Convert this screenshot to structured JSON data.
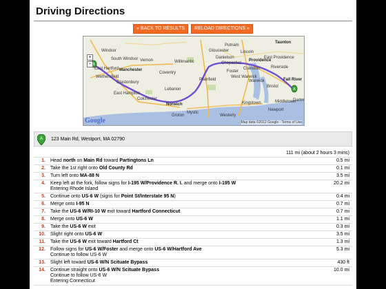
{
  "page": {
    "title": "Driving Directions"
  },
  "buttons": {
    "back": "« BACK TO RESULTS",
    "reload": "RELOAD DIRECTIONS »"
  },
  "map": {
    "labels": [
      "Windsor",
      "South Windsor",
      "Vernon",
      "East Hartford",
      "Manchester",
      "Glastonbury",
      "Willimantic",
      "Danielson",
      "Putnam",
      "Foster",
      "Coventry",
      "Lebanon",
      "Colchester",
      "Norwich",
      "Plainfield",
      "Groton",
      "Mystic",
      "Westerly",
      "Providence",
      "East Providence",
      "Cranston",
      "Warwick",
      "West Warwick",
      "Riverside",
      "Taunton",
      "Fall River",
      "Kingstown",
      "Bristol",
      "Newport",
      "Middletown",
      "Lincoln",
      "Gloucester",
      "Chepachet",
      "East Hampton",
      "Wethersfield",
      "Dartm"
    ],
    "copyright": "Map data ©2012 Google - Terms of Use",
    "logo": "Google"
  },
  "start": {
    "address": "123 Main Rd, Westport, MA 02790",
    "marker": "A"
  },
  "summary": "111 mi (about 2 hours 3 mins)",
  "steps": [
    {
      "n": "1.",
      "parts": [
        [
          "Head ",
          false
        ],
        [
          "north",
          true
        ],
        [
          " on ",
          false
        ],
        [
          "Main Rd",
          true
        ],
        [
          " toward ",
          false
        ],
        [
          "Partingtons Ln",
          true
        ]
      ],
      "extra": [],
      "dist": "0.5 mi"
    },
    {
      "n": "2.",
      "parts": [
        [
          "Take the 1st right onto ",
          false
        ],
        [
          "Old County Rd",
          true
        ]
      ],
      "extra": [],
      "dist": "0.1 mi"
    },
    {
      "n": "3.",
      "parts": [
        [
          "Turn left onto ",
          false
        ],
        [
          "MA-88 N",
          true
        ]
      ],
      "extra": [],
      "dist": "3.5 mi"
    },
    {
      "n": "4.",
      "parts": [
        [
          "Keep left at the fork, follow signs for ",
          false
        ],
        [
          "I-195 W/Providence R. I.",
          true
        ],
        [
          " and merge onto ",
          false
        ],
        [
          "I-195 W",
          true
        ]
      ],
      "extra": [
        "Entering Rhode Island"
      ],
      "dist": "20.2 mi"
    },
    {
      "n": "5.",
      "parts": [
        [
          "Continue onto ",
          false
        ],
        [
          "US-6 W",
          true
        ],
        [
          " (signs for ",
          false
        ],
        [
          "Point St/Interstate 95 N",
          true
        ],
        [
          ")",
          false
        ]
      ],
      "extra": [],
      "dist": "0.4 mi"
    },
    {
      "n": "6.",
      "parts": [
        [
          "Merge onto ",
          false
        ],
        [
          "I-95 N",
          true
        ]
      ],
      "extra": [],
      "dist": "0.7 mi"
    },
    {
      "n": "7.",
      "parts": [
        [
          "Take the ",
          false
        ],
        [
          "US-6 W/RI-10 W",
          true
        ],
        [
          " exit toward ",
          false
        ],
        [
          "Hartford Connecticut",
          true
        ]
      ],
      "extra": [],
      "dist": "0.7 mi"
    },
    {
      "n": "8.",
      "parts": [
        [
          "Merge onto ",
          false
        ],
        [
          "US-6 W",
          true
        ]
      ],
      "extra": [],
      "dist": "1.1 mi"
    },
    {
      "n": "9.",
      "parts": [
        [
          "Take the ",
          false
        ],
        [
          "US-6 W",
          true
        ],
        [
          " exit",
          false
        ]
      ],
      "extra": [],
      "dist": "0.3 mi"
    },
    {
      "n": "10.",
      "parts": [
        [
          "Slight right onto ",
          false
        ],
        [
          "US-6 W",
          true
        ]
      ],
      "extra": [],
      "dist": "3.5 mi"
    },
    {
      "n": "11.",
      "parts": [
        [
          "Take the ",
          false
        ],
        [
          "US-6 W",
          true
        ],
        [
          " exit toward ",
          false
        ],
        [
          "Hartford Ct",
          true
        ]
      ],
      "extra": [],
      "dist": "1.3 mi"
    },
    {
      "n": "12.",
      "parts": [
        [
          "Follow signs for ",
          false
        ],
        [
          "US-6 W/Foster",
          true
        ],
        [
          " and merge onto ",
          false
        ],
        [
          "US-6 W/Hartford Ave",
          true
        ]
      ],
      "extra": [
        "Continue to follow US-6 W"
      ],
      "dist": "5.3 mi"
    },
    {
      "n": "13.",
      "parts": [
        [
          "Slight left toward ",
          false
        ],
        [
          "US-6 W/N Scituate Bypass",
          true
        ]
      ],
      "extra": [],
      "dist": "430 ft"
    },
    {
      "n": "14.",
      "parts": [
        [
          "Continue straight onto ",
          false
        ],
        [
          "US-6 W/N Scituate Bypass",
          true
        ]
      ],
      "extra": [
        "Continue to follow US-6 W",
        "Entering Connecticut"
      ],
      "dist": "10.0 mi"
    }
  ]
}
